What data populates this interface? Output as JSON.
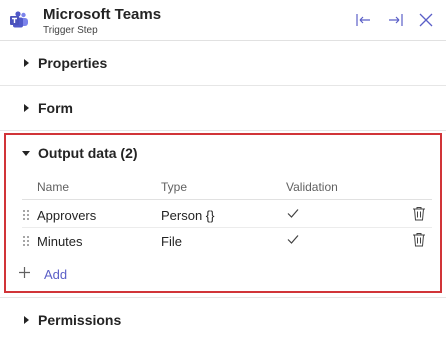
{
  "header": {
    "title": "Microsoft Teams",
    "subtitle": "Trigger Step",
    "app_icon": "teams-icon",
    "buttons": [
      "collapse-left-icon",
      "expand-right-icon",
      "close-icon"
    ]
  },
  "sections": [
    {
      "label": "Properties",
      "expanded": false
    },
    {
      "label": "Form",
      "expanded": false
    },
    {
      "label": "Output data (2)",
      "expanded": true
    },
    {
      "label": "Permissions",
      "expanded": false
    }
  ],
  "output": {
    "columns": [
      "Name",
      "Type",
      "Validation"
    ],
    "rows": [
      {
        "name": "Approvers",
        "type": "Person {}",
        "validation": "check-icon"
      },
      {
        "name": "Minutes",
        "type": "File",
        "validation": "check-icon"
      }
    ],
    "add_label": "Add"
  },
  "colors": {
    "highlight_border": "#d13438",
    "accent": "#5b5fc7",
    "icon_gray": "#616161"
  }
}
